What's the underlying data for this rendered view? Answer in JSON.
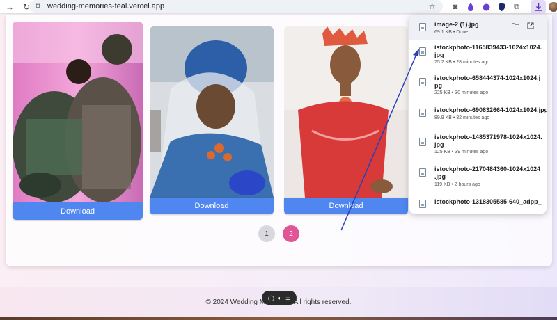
{
  "browser": {
    "url": "wedding-memories-teal.vercel.app",
    "icons": [
      "back-icon",
      "reload-icon",
      "site-info-icon",
      "star-icon",
      "camera-icon",
      "extension-icon",
      "download-icon",
      "avatar"
    ]
  },
  "gallery": {
    "items": [
      {
        "download_label": "Download"
      },
      {
        "download_label": "Download"
      },
      {
        "download_label": "Download"
      }
    ]
  },
  "pagination": {
    "pages": [
      "1",
      "2"
    ],
    "active_page": "2",
    "active_color": "#e05595",
    "inactive_color": "#d7d9de"
  },
  "footer": {
    "text": "© 2024 Wedding Memories. All rights reserved."
  },
  "downloads": {
    "items": [
      {
        "name_line1": "image-2 (1).jpg",
        "name_line2": "",
        "meta": "69.1 KB • Done"
      },
      {
        "name_line1": "istockphoto-1165839433-1024x1024.",
        "name_line2": "jpg",
        "meta": "75.2 KB • 28 minutes ago"
      },
      {
        "name_line1": "istockphoto-658444374-1024x1024.j",
        "name_line2": "pg",
        "meta": "225 KB • 30 minutes ago"
      },
      {
        "name_line1": "istockphoto-690832664-1024x1024.jpg",
        "name_line2": "",
        "meta": "89.9 KB • 32 minutes ago"
      },
      {
        "name_line1": "istockphoto-1485371978-1024x1024.",
        "name_line2": "jpg",
        "meta": "125 KB • 39 minutes ago"
      },
      {
        "name_line1": "istockphoto-2170484360-1024x1024",
        "name_line2": ".jpg",
        "meta": "119 KB • 2 hours ago"
      },
      {
        "name_line1": "istockphoto-1318305585-640_adpp_",
        "name_line2": "",
        "meta": ""
      }
    ]
  },
  "colors": {
    "download_button": "#4f86f0",
    "annotation_arrow": "#2a3fb8"
  }
}
